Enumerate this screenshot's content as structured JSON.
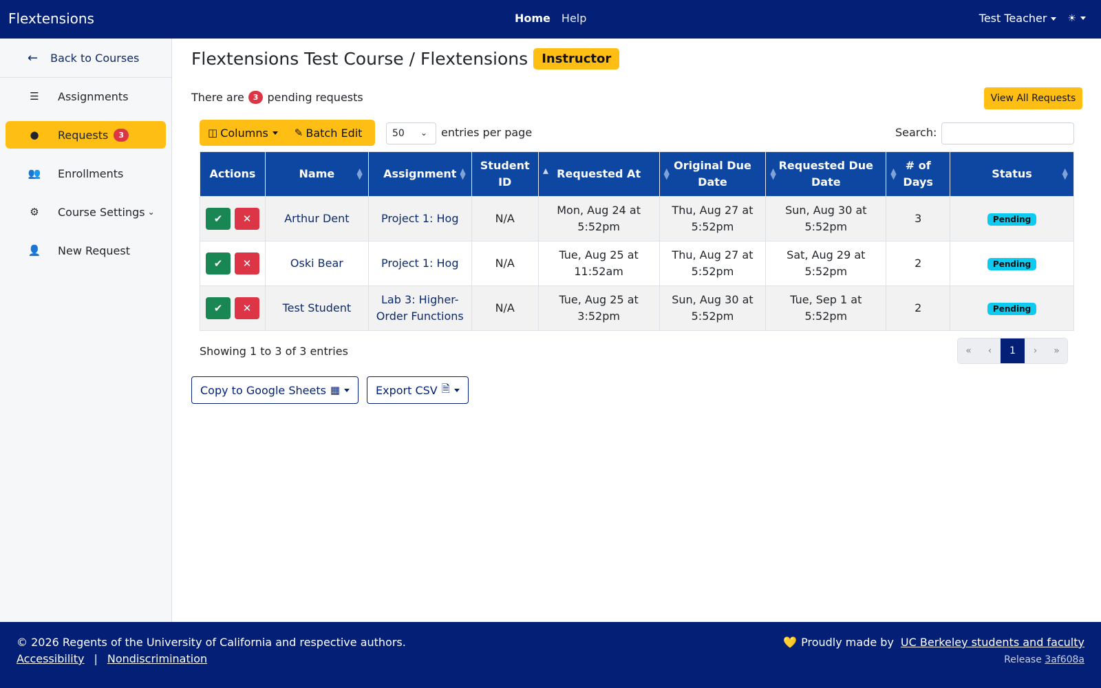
{
  "navbar": {
    "brand": "Flextensions",
    "home": "Home",
    "help": "Help",
    "user": "Test Teacher",
    "theme_icon": "☀"
  },
  "sidebar": {
    "back": "Back to Courses",
    "items": [
      {
        "label": "Assignments",
        "icon": "list-check-icon"
      },
      {
        "label": "Requests",
        "icon": "clock-icon",
        "badge": "3",
        "active": true
      },
      {
        "label": "Enrollments",
        "icon": "users-icon"
      },
      {
        "label": "Course Settings",
        "icon": "gear-icon",
        "chevron": "⌄"
      },
      {
        "label": "New Request",
        "icon": "user-plus-icon"
      }
    ]
  },
  "main": {
    "title": "Flextensions Test Course / Flextensions",
    "role_badge": "Instructor",
    "pending_prefix": "There are",
    "pending_count": "3",
    "pending_suffix": "pending requests",
    "view_all": "View All Requests",
    "columns_btn": "Columns",
    "batch_edit": "Batch Edit",
    "entries_value": "50",
    "entries_label": "entries per page",
    "search_label": "Search:",
    "search_value": ""
  },
  "table": {
    "headers": [
      "Actions",
      "Name",
      "Assignment",
      "Student ID",
      "Requested At",
      "Original Due Date",
      "Requested Due Date",
      "# of Days",
      "Status"
    ],
    "rows": [
      {
        "name": "Arthur Dent",
        "assignment": "Project 1: Hog",
        "student_id": "N/A",
        "requested_at": "Mon, Aug 24 at 5:52pm",
        "original_due": "Thu, Aug 27 at 5:52pm",
        "requested_due": "Sun, Aug 30 at 5:52pm",
        "days": "3",
        "status": "Pending"
      },
      {
        "name": "Oski Bear",
        "assignment": "Project 1: Hog",
        "student_id": "N/A",
        "requested_at": "Tue, Aug 25 at 11:52am",
        "original_due": "Thu, Aug 27 at 5:52pm",
        "requested_due": "Sat, Aug 29 at 5:52pm",
        "days": "2",
        "status": "Pending"
      },
      {
        "name": "Test Student",
        "assignment": "Lab 3: Higher-Order Functions",
        "student_id": "N/A",
        "requested_at": "Tue, Aug 25 at 3:52pm",
        "original_due": "Sun, Aug 30 at 5:52pm",
        "requested_due": "Tue, Sep 1 at 5:52pm",
        "days": "2",
        "status": "Pending"
      }
    ]
  },
  "pagination": {
    "showing": "Showing 1 to 3 of 3 entries",
    "first": "«",
    "prev": "‹",
    "current": "1",
    "next": "›",
    "last": "»"
  },
  "export": {
    "copy_sheets": "Copy to Google Sheets",
    "export_csv": "Export CSV"
  },
  "footer": {
    "copyright": "© 2026 Regents of the University of California and respective authors.",
    "accessibility": "Accessibility",
    "separator": "|",
    "nondiscrimination": "Nondiscrimination",
    "made_by_prefix": "Proudly made by",
    "made_by_link": "UC Berkeley students and faculty",
    "release_prefix": "Release",
    "release_hash": "3af608a"
  },
  "colors": {
    "navy": "#032076",
    "gold": "#ffbe14",
    "table_header": "#0d47a1",
    "approve": "#198754",
    "deny": "#dc3545",
    "pending": "#0dcaf0"
  }
}
